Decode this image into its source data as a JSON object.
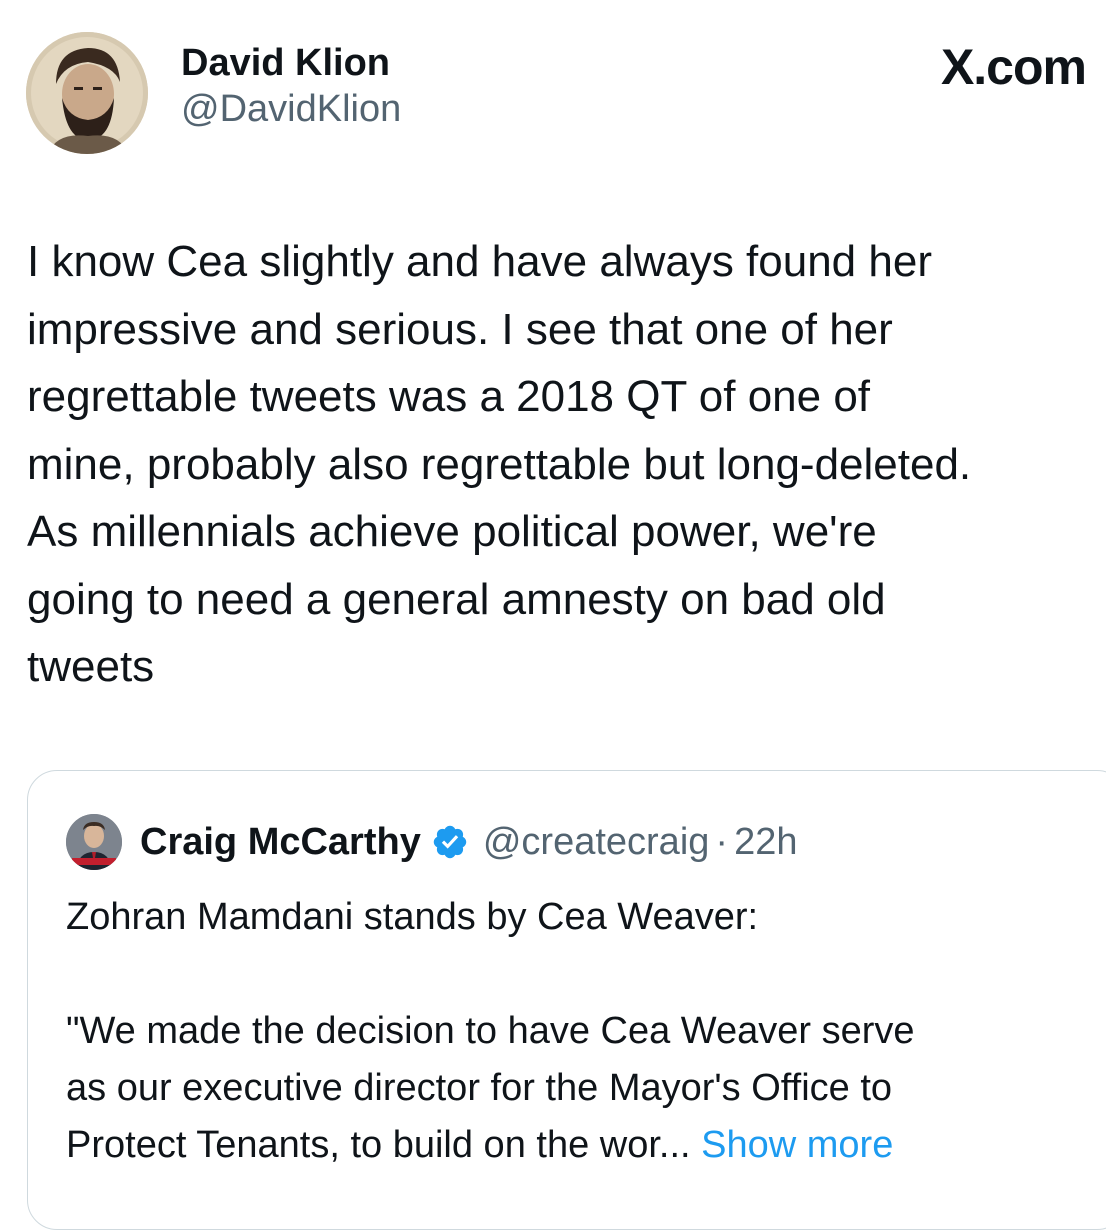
{
  "brand": {
    "label": "X.com"
  },
  "tweet": {
    "author": {
      "name": "David Klion",
      "handle": "@DavidKlion"
    },
    "text_lines": [
      "I know Cea slightly and have always found her",
      "impressive and serious. I see that one of her",
      "regrettable tweets was a 2018 QT of one of",
      "mine, probably also regrettable but long-deleted.",
      "As millennials achieve political power, we're",
      "going to need a general amnesty on bad old",
      "tweets"
    ]
  },
  "quoted_tweet": {
    "author": {
      "name": "Craig McCarthy",
      "handle": "@createcraig",
      "verified": true
    },
    "separator": "·",
    "time": "22h",
    "paragraph1": "Zohran Mamdani stands by Cea Weaver:",
    "paragraph2_lines": [
      "\"We made the decision to have Cea Weaver serve",
      "as our executive director for the Mayor's Office to",
      "Protect Tenants, to build on the wor..."
    ],
    "show_more_label": "Show more"
  },
  "colors": {
    "text_primary": "#0f1419",
    "text_secondary": "#536471",
    "link": "#1d9bf0",
    "verified_badge": "#1d9bf0",
    "border": "#cfd9de"
  },
  "icons": {
    "verified": "verified-badge-icon",
    "brand": "x-logo-icon"
  }
}
